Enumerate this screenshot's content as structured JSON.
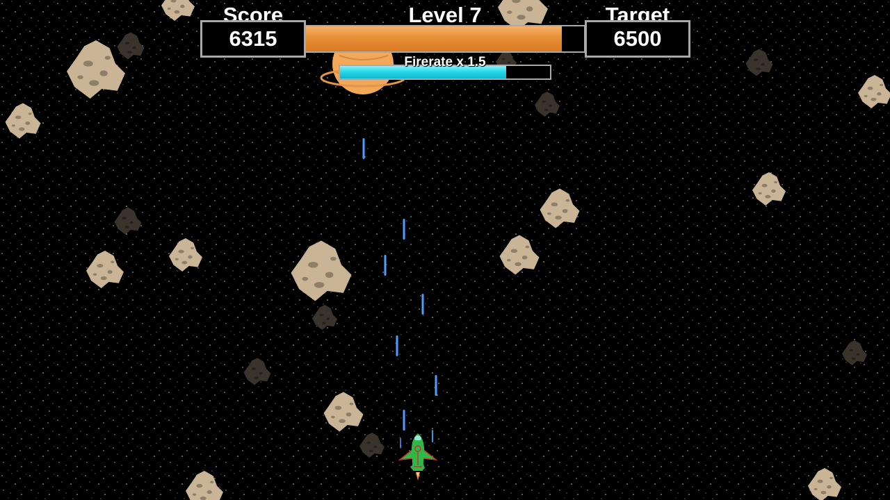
{
  "hud": {
    "score_label": "Score",
    "score_value": "6315",
    "level_label": "Level 7",
    "target_label": "Target",
    "target_value": "6500",
    "level_progress": 0.92,
    "powerup_label": "Firerate x 1.5",
    "powerup_remaining": 0.79
  },
  "colors": {
    "background": "#000000",
    "level_bar": "#e8913a",
    "powerup_bar": "#22d6e6",
    "asteroid_light": "#c9b596",
    "asteroid_dark": "#3a332c",
    "laser": "#4aa0ff",
    "ship": "#2fb84a"
  },
  "sprites": {
    "player": "green-spaceship",
    "projectile": "blue-laser-bolt",
    "obstacle": "asteroid",
    "background_object": "ringed-planet"
  }
}
